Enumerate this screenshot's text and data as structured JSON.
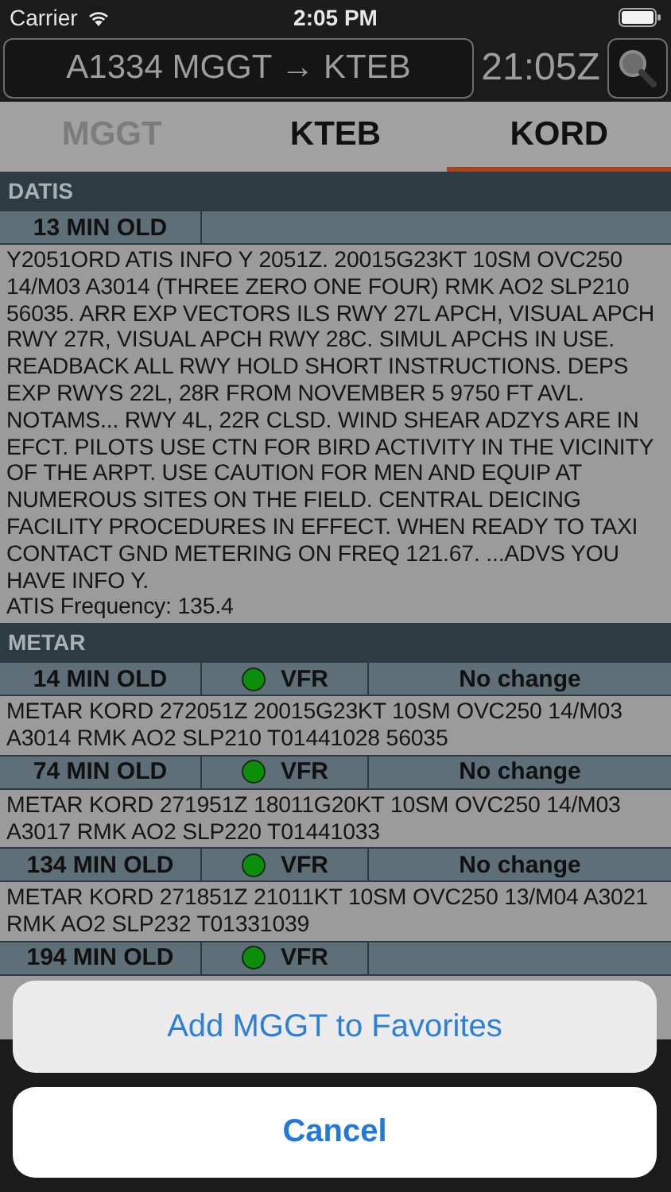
{
  "status_bar": {
    "carrier": "Carrier",
    "time": "2:05 PM"
  },
  "header": {
    "route": "A1334 MGGT → KTEB",
    "zulu_time": "21:05Z"
  },
  "airport_tabs": [
    {
      "label": "MGGT",
      "selected": false,
      "disabled": true
    },
    {
      "label": "KTEB",
      "selected": false,
      "disabled": false
    },
    {
      "label": "KORD",
      "selected": true,
      "disabled": false
    }
  ],
  "sections": [
    {
      "title": "DATIS",
      "kind": "atis",
      "reports": [
        {
          "age": "13 MIN OLD",
          "text": "Y2051ORD ATIS INFO Y 2051Z. 20015G23KT 10SM OVC250 14/M03 A3014 (THREE ZERO ONE FOUR) RMK AO2 SLP210 56035. ARR EXP VECTORS ILS RWY 27L APCH, VISUAL APCH RWY 27R, VISUAL APCH RWY 28C. SIMUL APCHS IN USE. READBACK ALL RWY HOLD SHORT INSTRUCTIONS. DEPS EXP RWYS 22L, 28R FROM NOVEMBER 5 9750 FT AVL. NOTAMS... RWY 4L, 22R CLSD. WIND SHEAR ADZYS ARE IN EFCT. PILOTS USE CTN FOR BIRD ACTIVITY IN THE VICINITY OF THE ARPT. USE CAUTION FOR MEN AND EQUIP AT NUMEROUS SITES ON THE FIELD. CENTRAL DEICING FACILITY PROCEDURES IN EFFECT. WHEN READY TO TAXI CONTACT GND METERING ON FREQ 121.67. ...ADVS YOU HAVE INFO Y.",
          "frequency": "ATIS Frequency:  135.4"
        }
      ]
    },
    {
      "title": "METAR",
      "kind": "metar",
      "reports": [
        {
          "age": "14 MIN OLD",
          "flight_rules": "VFR",
          "color": "#0b8f0b",
          "trend": "No change",
          "text": "METAR KORD 272051Z 20015G23KT 10SM OVC250 14/M03 A3014 RMK AO2 SLP210 T01441028 56035"
        },
        {
          "age": "74 MIN OLD",
          "flight_rules": "VFR",
          "color": "#0b8f0b",
          "trend": "No change",
          "text": "METAR KORD 271951Z 18011G20KT 10SM OVC250 14/M03 A3017 RMK AO2 SLP220 T01441033"
        },
        {
          "age": "134 MIN OLD",
          "flight_rules": "VFR",
          "color": "#0b8f0b",
          "trend": "No change",
          "text": "METAR KORD 271851Z 21011KT 10SM OVC250 13/M04 A3021 RMK AO2 SLP232 T01331039"
        },
        {
          "age": "194 MIN OLD",
          "flight_rules": "VFR",
          "color": "#0b8f0b"
        }
      ]
    }
  ],
  "action_sheet": {
    "actions": [
      "Add MGGT to Favorites"
    ],
    "cancel": "Cancel"
  }
}
